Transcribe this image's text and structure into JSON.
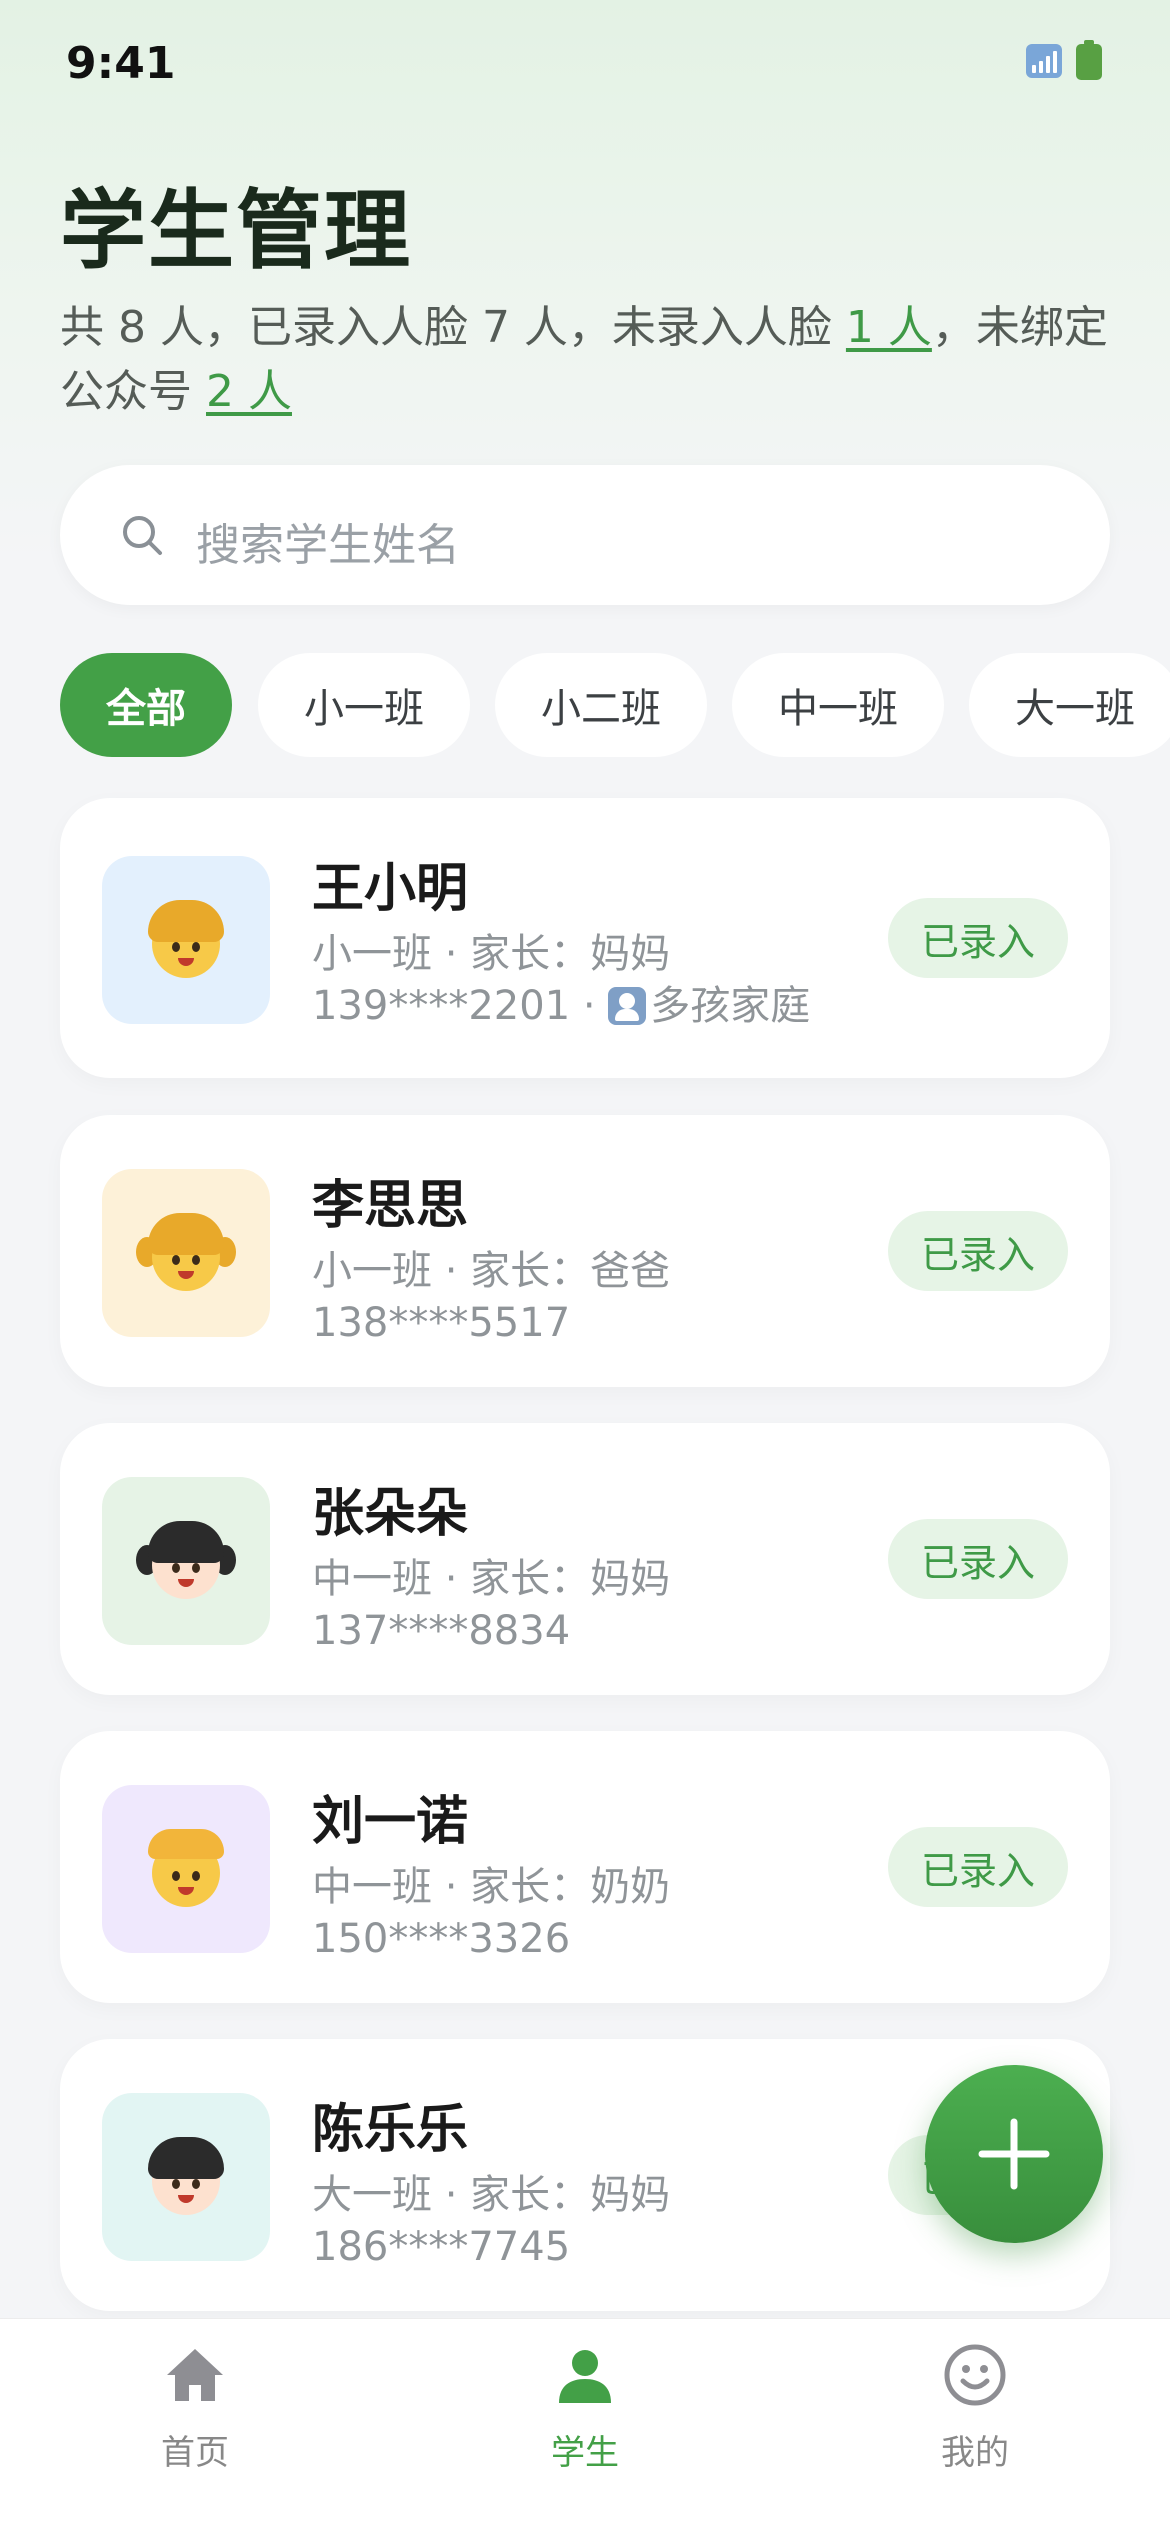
{
  "status_bar": {
    "time": "9:41"
  },
  "header": {
    "title": "学生管理",
    "summary_prefix": "共 8 人，已录入人脸 7 人，未录入人脸 ",
    "unregistered_face_link": "1 人",
    "summary_middle": "，未绑定公众号 ",
    "unbound_link": "2 人"
  },
  "search": {
    "placeholder": "搜索学生姓名"
  },
  "tabs": [
    "全部",
    "小一班",
    "小二班",
    "中一班",
    "大一班"
  ],
  "students": [
    {
      "name": "王小明",
      "class_parent": "小一班 · 家长：妈妈",
      "phone": "139****2201 · ",
      "tag": "多孩家庭",
      "status": "已录入",
      "avatar_bg": "#e3f0fd"
    },
    {
      "name": "李思思",
      "class_parent": "小一班 · 家长：爸爸",
      "phone": "138****5517",
      "status": "已录入",
      "avatar_bg": "#fdf1d8"
    },
    {
      "name": "张朵朵",
      "class_parent": "中一班 · 家长：妈妈",
      "phone": "137****8834",
      "status": "已录入",
      "avatar_bg": "#e6f3e6"
    },
    {
      "name": "刘一诺",
      "class_parent": "中一班 · 家长：奶奶",
      "phone": "150****3326",
      "status": "已录入",
      "avatar_bg": "#efe8fd"
    },
    {
      "name": "陈乐乐",
      "class_parent": "大一班 · 家长：妈妈",
      "phone": "186****7745",
      "status": "已录入",
      "avatar_bg": "#e2f5f3"
    }
  ],
  "tabbar": {
    "home": "首页",
    "students": "学生",
    "mine": "我的"
  },
  "colors": {
    "accent": "#43a047",
    "badge_bg": "#e6f4e6"
  }
}
